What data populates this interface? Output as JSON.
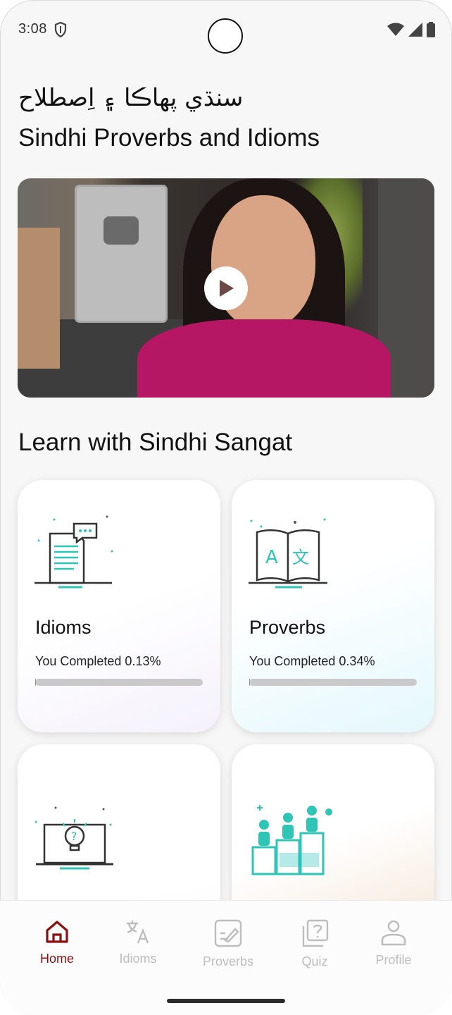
{
  "status_bar": {
    "time": "3:08"
  },
  "header": {
    "title_sindhi": "سنڌي پهاڪا ۽ اِصطلاح",
    "title_english": "Sindhi Proverbs and Idioms"
  },
  "video": {
    "play_icon": "play-icon"
  },
  "section": {
    "title": "Learn with Sindhi Sangat"
  },
  "cards": [
    {
      "title": "Idioms",
      "progress_text": "You Completed 0.13%",
      "progress": 0.0013,
      "icon": "document-chat-icon"
    },
    {
      "title": "Proverbs",
      "progress_text": "You Completed 0.34%",
      "progress": 0.0034,
      "icon": "translate-book-icon"
    },
    {
      "icon": "laptop-idea-icon"
    },
    {
      "icon": "people-podium-icon"
    }
  ],
  "bottom_nav": {
    "items": [
      {
        "label": "Home",
        "icon": "home-icon",
        "active": true
      },
      {
        "label": "Idioms",
        "icon": "translate-icon",
        "active": false
      },
      {
        "label": "Proverbs",
        "icon": "edit-note-icon",
        "active": false
      },
      {
        "label": "Quiz",
        "icon": "quiz-icon",
        "active": false
      },
      {
        "label": "Profile",
        "icon": "profile-icon",
        "active": false
      }
    ]
  },
  "colors": {
    "accent": "#8b1010",
    "inactive_nav": "#bdbdbd",
    "teal_icon": "#2ec4b6",
    "progress_track": "#c9c9cc"
  }
}
